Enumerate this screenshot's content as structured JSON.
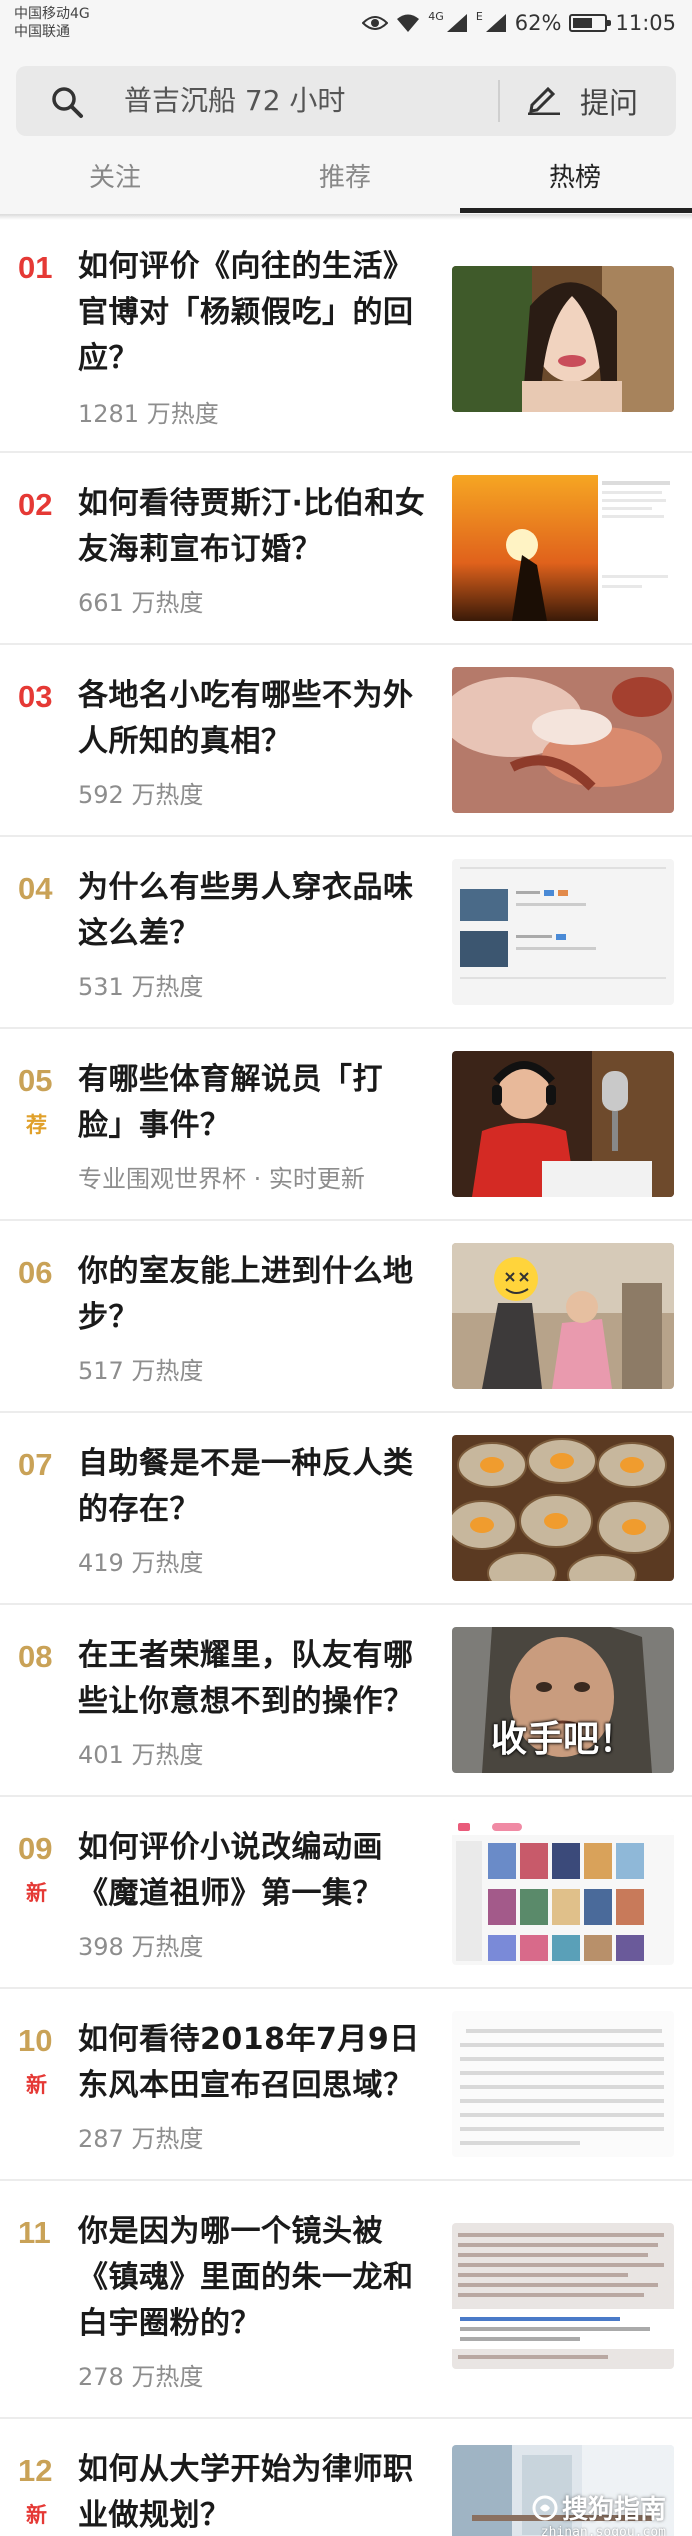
{
  "status_bar": {
    "carrier_1": "中国移动4G",
    "carrier_2": "中国联通",
    "signal_1_label": "4G",
    "signal_2_label": "E",
    "battery": "62%",
    "battery_level": 0.62,
    "time": "11:05"
  },
  "search": {
    "placeholder_text": "普吉沉船 72 小时",
    "ask_label": "提问"
  },
  "tabs": [
    {
      "label": "关注",
      "active": false
    },
    {
      "label": "推荐",
      "active": false
    },
    {
      "label": "热榜",
      "active": true
    }
  ],
  "colors": {
    "rank_top": "#e53935",
    "rank_other": "#c9a257",
    "badge_new": "#e53935",
    "badge_recommend": "#e0a02a"
  },
  "items": [
    {
      "rank": "01",
      "badge": "",
      "title": "如何评价《向往的生活》官博对「杨颖假吃」的回应？",
      "heat": "1281 万热度",
      "thumb": "woman-eating-photo"
    },
    {
      "rank": "02",
      "badge": "",
      "title": "如何看待贾斯汀·比伯和女友海莉宣布订婚？",
      "heat": "661 万热度",
      "thumb": "sunset-couple-photo"
    },
    {
      "rank": "03",
      "badge": "",
      "title": "各地名小吃有哪些不为外人所知的真相？",
      "heat": "592 万热度",
      "thumb": "crayfish-photo"
    },
    {
      "rank": "04",
      "badge": "",
      "title": "为什么有些男人穿衣品味这么差？",
      "heat": "531 万热度",
      "thumb": "screenshot-listing"
    },
    {
      "rank": "05",
      "badge": "荐",
      "title": "有哪些体育解说员「打脸」事件？",
      "heat": "专业围观世界杯 · 实时更新",
      "thumb": "commentator-photo"
    },
    {
      "rank": "06",
      "badge": "",
      "title": "你的室友能上进到什么地步？",
      "heat": "517 万热度",
      "thumb": "roommates-photo"
    },
    {
      "rank": "07",
      "badge": "",
      "title": "自助餐是不是一种反人类的存在？",
      "heat": "419 万热度",
      "thumb": "scallops-photo"
    },
    {
      "rank": "08",
      "badge": "",
      "title": "在王者荣耀里，队友有哪些让你意想不到的操作？",
      "heat": "401 万热度",
      "thumb": "meme-photo",
      "thumb_caption": "收手吧！"
    },
    {
      "rank": "09",
      "badge": "新",
      "title": "如何评价小说改编动画《魔道祖师》第一集？",
      "heat": "398 万热度",
      "thumb": "video-site-screenshot"
    },
    {
      "rank": "10",
      "badge": "新",
      "title": "如何看待2018年7月9日东风本田宣布召回思域？",
      "heat": "287 万热度",
      "thumb": "text-document"
    },
    {
      "rank": "11",
      "badge": "",
      "title": "你是因为哪一个镜头被《镇魂》里面的朱一龙和白宇圈粉的？",
      "heat": "278 万热度",
      "thumb": "comment-screenshot"
    },
    {
      "rank": "12",
      "badge": "新",
      "title": "如何从大学开始为律师职业做规划？",
      "heat": "",
      "thumb": "office-photo",
      "watermark": "搜狗指南",
      "watermark_url": "zhinan.sogou.com"
    }
  ]
}
